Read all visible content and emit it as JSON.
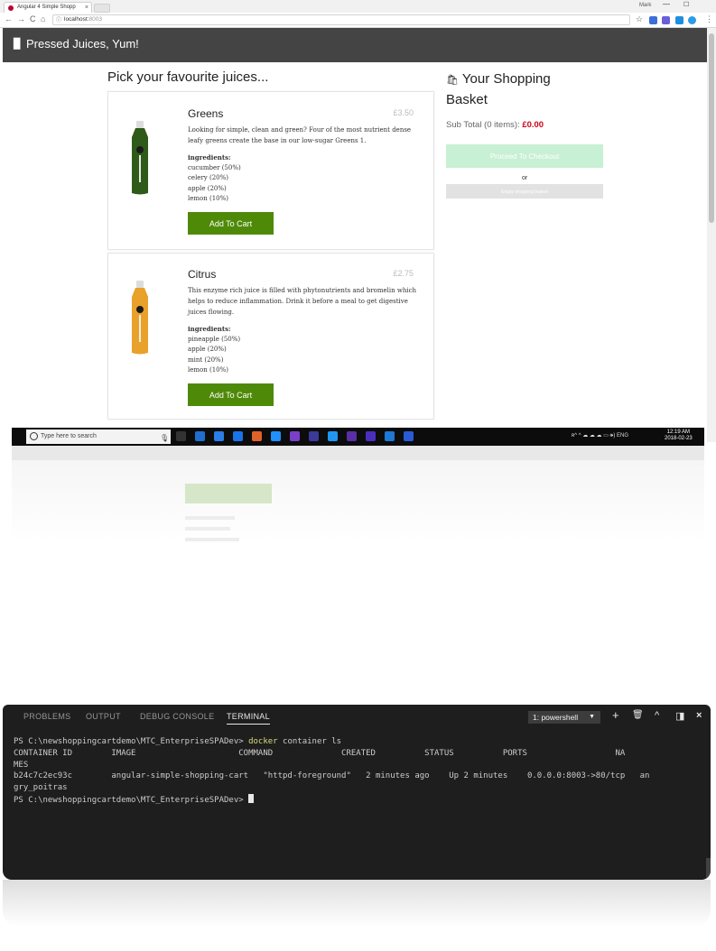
{
  "browser": {
    "tab_title": "Angular 4 Simple Shopp",
    "tab_close": "×",
    "window_label": "Mark",
    "window_min": "—",
    "window_max": "☐",
    "back": "←",
    "forward": "→",
    "reload": "C",
    "home": "⌂",
    "url_info": "ⓘ",
    "url_host": "localhost:",
    "url_port": "8003",
    "star": "☆",
    "menu": "⋮",
    "extension_colors": [
      "#3b6fd8",
      "#6a5fd8",
      "#1e8fe0",
      "#2b9be8"
    ]
  },
  "header": {
    "logo": "▉",
    "title": "Pressed Juices, Yum!"
  },
  "products_heading": "Pick your favourite juices...",
  "products": [
    {
      "name": "Greens",
      "price": "£3.50",
      "description": "Looking for simple, clean and green? Four of the most nutrient dense leafy greens create the base in our low-sugar Greens 1.",
      "ingredients_label": "ingredients:",
      "ingredients": [
        "cucumber (50%)",
        "celery (20%)",
        "apple (20%)",
        "lemon (10%)"
      ],
      "button": "Add To Cart",
      "bottle_color": "#2f5a1a"
    },
    {
      "name": "Citrus",
      "price": "£2.75",
      "description": "This enzyme rich juice is filled with phytonutrients and bromelin which helps to reduce inflammation. Drink it before a meal to get digestive juices flowing.",
      "ingredients_label": "ingredients:",
      "ingredients": [
        "pineapple (50%)",
        "apple (20%)",
        "mint (20%)",
        "lemon (10%)"
      ],
      "button": "Add To Cart",
      "bottle_color": "#e8a12a"
    }
  ],
  "basket": {
    "icon": "🛍",
    "title": "Your Shopping Basket",
    "subtotal_label": "Sub Total (0 items): ",
    "subtotal_amount": "£0.00",
    "checkout_button": "Proceed To Checkout",
    "or": "or",
    "empty_button": "Empty shopping basket"
  },
  "taskbar": {
    "search_placeholder": "Type here to search",
    "mic": "🎙",
    "app_icon_colors": [
      "#333333",
      "#1f6fd0",
      "#2b7de9",
      "#1a73e8",
      "#e0622a",
      "#1e90ff",
      "#7a3fc9",
      "#3a3a9a",
      "#2196f3",
      "#5a2ea6",
      "#4a2fbf",
      "#1e78d6",
      "#2a5bd7"
    ],
    "tray": "ʀ^  ^ ☁ ☁ ☁ ▭ 🕪) ENG",
    "time": "12:19 AM",
    "date": "2018-02-23"
  },
  "terminal": {
    "tabs": [
      "PROBLEMS",
      "OUTPUT",
      "DEBUG CONSOLE",
      "TERMINAL"
    ],
    "active_tab": "TERMINAL",
    "shell": "1: powershell",
    "shell_caret": "▼",
    "add_icon": "+",
    "trash_icon": "🗑",
    "up_icon": "^",
    "split_icon": "◨",
    "close_icon": "×",
    "prompt": "PS C:\\newshoppingcartdemo\\MTC_EnterpriseSPADev> ",
    "command": "docker",
    "command_rest": " container ls",
    "header_line": "CONTAINER ID        IMAGE                     COMMAND              CREATED          STATUS          PORTS                  NA",
    "header_wrap": "MES",
    "row_line": "b24c7c2ec93c        angular-simple-shopping-cart   \"httpd-foreground\"   2 minutes ago    Up 2 minutes    0.0.0.0:8003->80/tcp   an",
    "row_wrap": "gry_poitras",
    "prompt2": "PS C:\\newshoppingcartdemo\\MTC_EnterpriseSPADev> "
  }
}
